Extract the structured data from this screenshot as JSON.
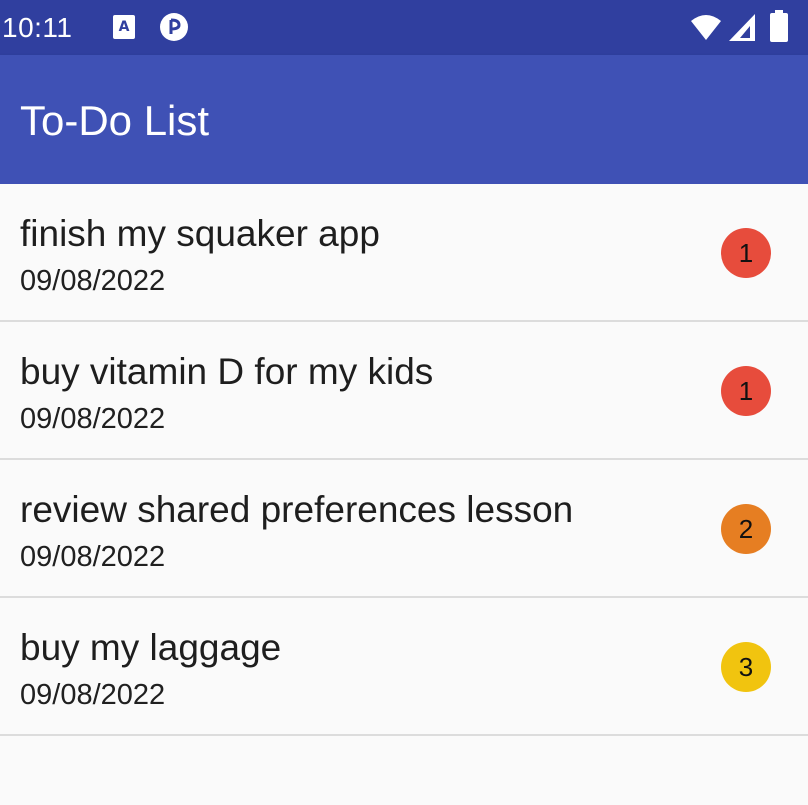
{
  "status_bar": {
    "time": "10:11",
    "notification_icons": [
      "a-icon",
      "cast-icon"
    ],
    "system_icons": [
      "wifi-icon",
      "signal-icon",
      "battery-icon"
    ]
  },
  "app_bar": {
    "title": "To-Do List"
  },
  "tasks": [
    {
      "title": "finish my squaker app",
      "date": "09/08/2022",
      "priority": "1",
      "priority_color": "#e74c3c"
    },
    {
      "title": "buy vitamin D for my kids",
      "date": "09/08/2022",
      "priority": "1",
      "priority_color": "#e74c3c"
    },
    {
      "title": "review shared preferences lesson",
      "date": "09/08/2022",
      "priority": "2",
      "priority_color": "#e67e22"
    },
    {
      "title": "buy my laggage",
      "date": "09/08/2022",
      "priority": "3",
      "priority_color": "#f1c40f"
    }
  ],
  "colors": {
    "status_bar": "#303f9f",
    "app_bar": "#3f51b5",
    "background": "#fafafa"
  }
}
